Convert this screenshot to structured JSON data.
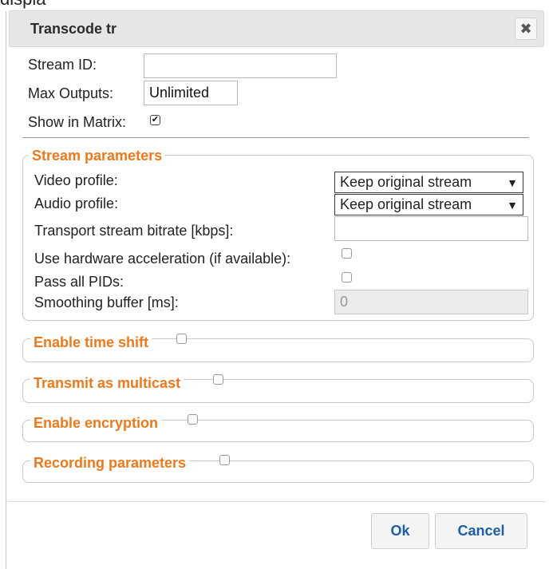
{
  "background_fragment": "displa",
  "dialog": {
    "title": "Transcode tr",
    "close_glyph": "✖"
  },
  "general": {
    "stream_id_label": "Stream ID:",
    "stream_id_value": "",
    "max_outputs_label": "Max Outputs:",
    "max_outputs_value": "Unlimited",
    "show_in_matrix_label": "Show in Matrix:",
    "show_in_matrix_checked": true
  },
  "stream_parameters": {
    "legend": "Stream parameters",
    "video_profile_label": "Video profile:",
    "video_profile_value": "Keep original stream",
    "audio_profile_label": "Audio profile:",
    "audio_profile_value": "Keep original stream",
    "ts_bitrate_label": "Transport stream bitrate [kbps]:",
    "ts_bitrate_value": "",
    "hw_accel_label": "Use hardware acceleration (if available):",
    "hw_accel_checked": false,
    "pass_pids_label": "Pass all PIDs:",
    "pass_pids_checked": false,
    "smoothing_label": "Smoothing buffer [ms]:",
    "smoothing_value": "0"
  },
  "sections": {
    "time_shift": "Enable time shift",
    "multicast": "Transmit as multicast",
    "encryption": "Enable encryption",
    "recording": "Recording parameters"
  },
  "footer": {
    "ok_label": "Ok",
    "cancel_label": "Cancel"
  },
  "colors": {
    "accent": "#f07818",
    "button_text": "#1a5fa8",
    "titlebar": "#e6e6e6"
  },
  "icons": {
    "close": "close-icon",
    "dropdown": "triangle-down-icon",
    "check": "checkmark-icon"
  }
}
